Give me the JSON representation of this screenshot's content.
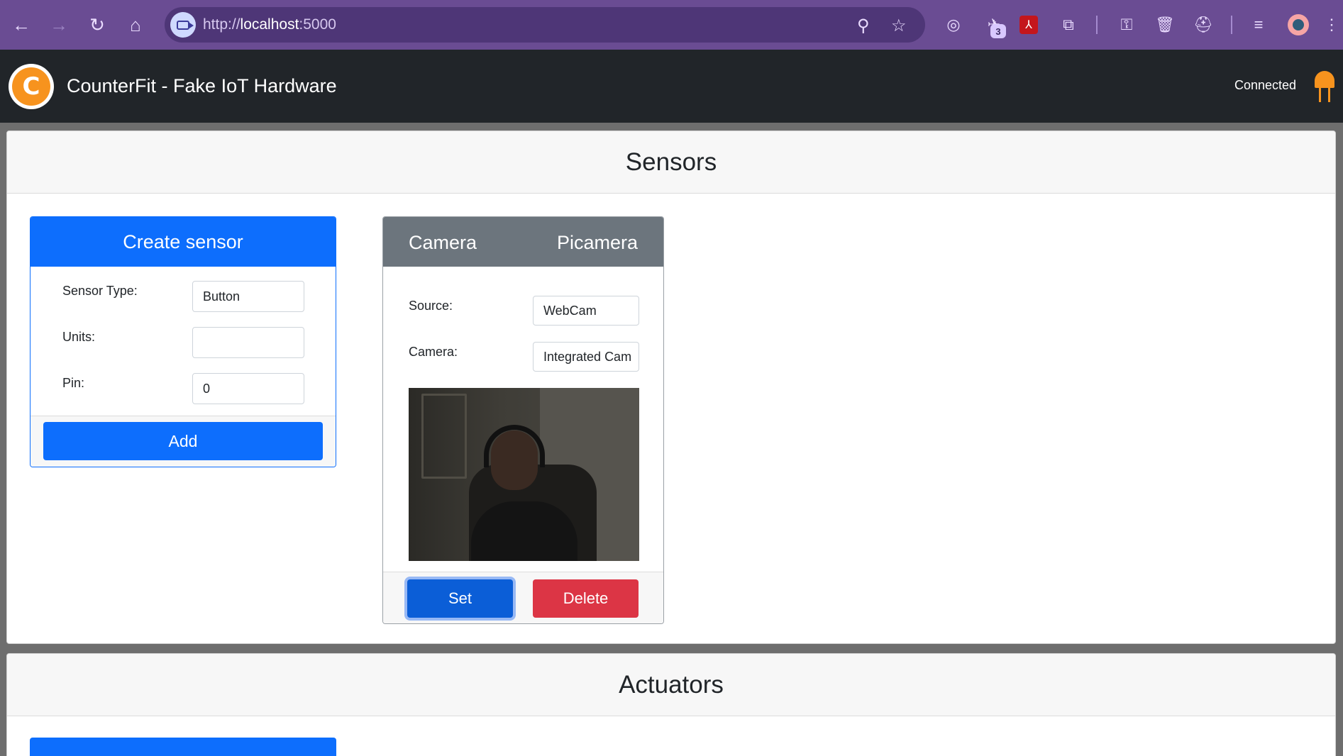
{
  "browser": {
    "back_icon": "arrow-left-icon",
    "forward_icon": "arrow-right-icon",
    "reload_icon": "reload-icon",
    "home_icon": "home-icon",
    "url_prefix": "http://",
    "url_host": "localhost",
    "url_port": ":5000",
    "extension_badge": "3"
  },
  "app": {
    "title": "CounterFit - Fake IoT Hardware",
    "logo_letter": "C",
    "status": "Connected",
    "accent": "#0d6efd",
    "header_bg": "#212529",
    "led_color": "#f7931e"
  },
  "sensors": {
    "heading": "Sensors",
    "create": {
      "title": "Create sensor",
      "sensor_type_label": "Sensor Type:",
      "sensor_type_value": "Button",
      "units_label": "Units:",
      "units_value": "",
      "pin_label": "Pin:",
      "pin_value": "0",
      "add_label": "Add"
    },
    "camera": {
      "type": "Camera",
      "name": "Picamera",
      "source_label": "Source:",
      "source_value": "WebCam",
      "camera_label": "Camera:",
      "camera_value": "Integrated Cam",
      "set_label": "Set",
      "delete_label": "Delete",
      "delete_color": "#dc3545"
    }
  },
  "actuators": {
    "heading": "Actuators"
  }
}
